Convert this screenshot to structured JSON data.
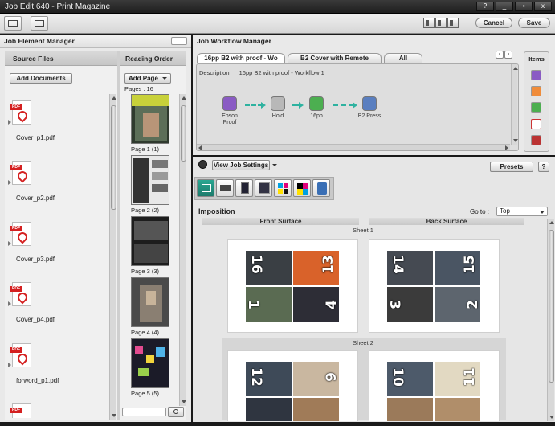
{
  "window": {
    "title": "Job Edit 640 - Print Magazine",
    "controls": [
      "?",
      "_",
      "▫",
      "x"
    ]
  },
  "toolbar": {
    "cancel_label": "Cancel",
    "save_label": "Save"
  },
  "job_element_manager": {
    "title": "Job Element Manager",
    "source_files": {
      "header": "Source Files",
      "add_button": "Add Documents",
      "files": [
        "Cover_p1.pdf",
        "Cover_p2.pdf",
        "Cover_p3.pdf",
        "Cover_p4.pdf",
        "forword_p1.pdf"
      ],
      "icon_label": "PDF"
    },
    "reading_order": {
      "header": "Reading Order",
      "add_button": "Add Page",
      "pages_count": "Pages : 16",
      "pages": [
        "Page 1 (1)",
        "Page 2 (2)",
        "Page 3 (3)",
        "Page 4 (4)",
        "Page 5 (5)"
      ]
    }
  },
  "workflow_manager": {
    "title": "Job Workflow Manager",
    "tabs": [
      "16pp B2 with proof - Wo",
      "B2 Cover with Remote",
      "All"
    ],
    "description_label": "Description",
    "description_value": "16pp B2 with proof - Workflow 1",
    "nodes": [
      {
        "label": "Epson Proof",
        "icon": "proof-icon",
        "color": "#8a5bc4"
      },
      {
        "label": "Hold",
        "icon": "pause-icon",
        "color": "#b8b8b8"
      },
      {
        "label": "16pp",
        "icon": "imposition-icon",
        "color": "#4caf50"
      },
      {
        "label": "B2 Press",
        "icon": "press-icon",
        "color": "#5a7fc0"
      }
    ],
    "items_title": "Items"
  },
  "job_settings": {
    "view_button": "View Job Settings",
    "presets_button": "Presets",
    "help_button": "?",
    "section_title": "Imposition",
    "goto_label": "Go to :",
    "goto_value": "Top",
    "front_surface": "Front Surface",
    "back_surface": "Back Surface",
    "sheets": [
      {
        "label": "Sheet 1",
        "front": [
          "16",
          "13",
          "1",
          "4"
        ],
        "back": [
          "14",
          "15",
          "3",
          "2"
        ]
      },
      {
        "label": "Sheet 2",
        "front": [
          "12",
          "9",
          "",
          ""
        ],
        "back": [
          "10",
          "11",
          "",
          ""
        ]
      }
    ]
  }
}
